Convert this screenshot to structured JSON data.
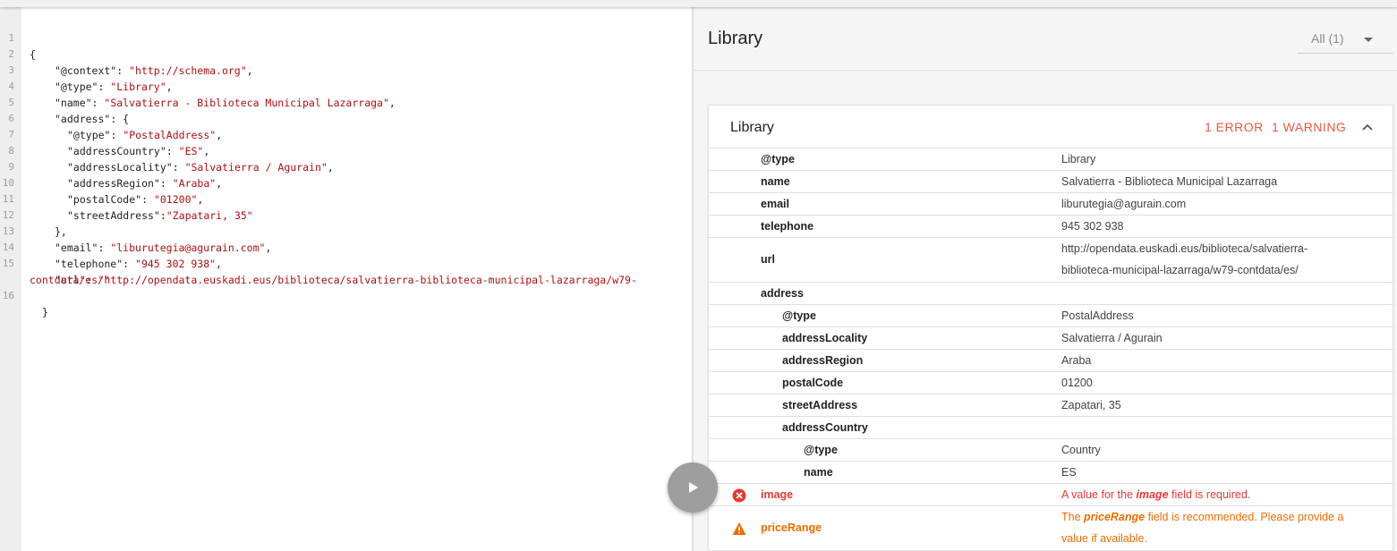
{
  "editor": {
    "lines": [
      {
        "n": "1",
        "text": "{"
      },
      {
        "n": "2",
        "key": "\"@context\"",
        "sep": ": ",
        "value": "\"http://schema.org\"",
        "tail": ","
      },
      {
        "n": "3",
        "key": "\"@type\"",
        "sep": ": ",
        "value": "\"Library\"",
        "tail": ","
      },
      {
        "n": "4",
        "key": "\"name\"",
        "sep": ": ",
        "value": "\"Salvatierra - Biblioteca Municipal Lazarraga\"",
        "tail": ","
      },
      {
        "n": "5",
        "key": "\"address\"",
        "sep": ": ",
        "value": "",
        "tail": "{"
      },
      {
        "n": "6",
        "key": "\"@type\"",
        "sep": ": ",
        "value": "\"PostalAddress\"",
        "tail": ","
      },
      {
        "n": "7",
        "key": "\"addressCountry\"",
        "sep": ": ",
        "value": "\"ES\"",
        "tail": ","
      },
      {
        "n": "8",
        "key": "\"addressLocality\"",
        "sep": ": ",
        "value": "\"Salvatierra / Agurain\"",
        "tail": ","
      },
      {
        "n": "9",
        "key": "\"addressRegion\"",
        "sep": ": ",
        "value": "\"Araba\"",
        "tail": ","
      },
      {
        "n": "10",
        "key": "\"postalCode\"",
        "sep": ": ",
        "value": "\"01200\"",
        "tail": ","
      },
      {
        "n": "11",
        "key": "\"streetAddress\"",
        "sep": ":",
        "value": "\"Zapatari, 35\"",
        "tail": ""
      },
      {
        "n": "12",
        "text": "},"
      },
      {
        "n": "13",
        "key": "\"email\"",
        "sep": ": ",
        "value": "\"liburutegia@agurain.com\"",
        "tail": ","
      },
      {
        "n": "14",
        "key": "\"telephone\"",
        "sep": ": ",
        "value": "\"945 302 938\"",
        "tail": ","
      },
      {
        "n": "15",
        "key": "\"url\"",
        "sep": ": ",
        "value": "\"http://opendata.euskadi.eus/biblioteca/salvatierra-biblioteca-municipal-lazarraga/w79-",
        "tail": ""
      },
      {
        "n": "",
        "value": "contdata/es/\""
      },
      {
        "n": "16",
        "text": "}"
      }
    ]
  },
  "results": {
    "title": "Library",
    "filter_label": "All (1)",
    "card": {
      "title": "Library",
      "errors": "1 ERROR",
      "warnings": "1 WARNING",
      "rows": [
        {
          "prop": "@type",
          "value": "Library"
        },
        {
          "prop": "name",
          "value": "Salvatierra - Biblioteca Municipal Lazarraga"
        },
        {
          "prop": "email",
          "value": "liburutegia@agurain.com"
        },
        {
          "prop": "telephone",
          "value": "945 302 938"
        },
        {
          "prop": "url",
          "value_line1": "http://opendata.euskadi.eus/biblioteca/salvatierra-",
          "value_line2": "biblioteca-municipal-lazarraga/w79-contdata/es/"
        },
        {
          "prop": "address",
          "value": ""
        },
        {
          "prop": "@type",
          "value": "PostalAddress"
        },
        {
          "prop": "addressLocality",
          "value": "Salvatierra / Agurain"
        },
        {
          "prop": "addressRegion",
          "value": "Araba"
        },
        {
          "prop": "postalCode",
          "value": "01200"
        },
        {
          "prop": "streetAddress",
          "value": "Zapatari, 35"
        },
        {
          "prop": "addressCountry",
          "value": ""
        },
        {
          "prop": "@type",
          "value": "Country"
        },
        {
          "prop": "name",
          "value": "ES"
        }
      ],
      "error_row": {
        "prop": "image",
        "msg_pre": "A value for the ",
        "msg_field": "image",
        "msg_post": " field is required."
      },
      "warning_row": {
        "prop": "priceRange",
        "msg_pre": "The ",
        "msg_field": "priceRange",
        "msg_post": " field is recommended. Please provide a",
        "msg_line2": "value if available."
      }
    }
  },
  "colors": {
    "error": "#e53935",
    "warning": "#ef6c00",
    "string": "#aa1111",
    "play_button": "#9e9e9e"
  },
  "icons": {
    "run": "play-icon",
    "error": "error-circle-icon",
    "warning": "warning-triangle-icon",
    "collapse": "chevron-up-icon",
    "filter": "dropdown-caret-icon"
  }
}
